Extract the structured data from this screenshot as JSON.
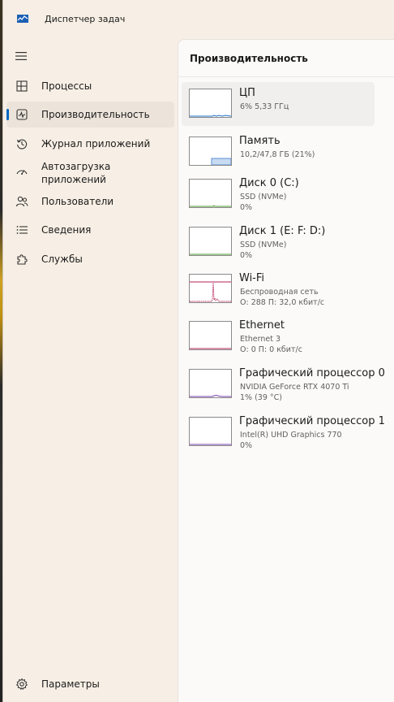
{
  "app": {
    "title": "Диспетчер задач",
    "icon": "task-manager-icon"
  },
  "nav": {
    "items": [
      {
        "label": "Процессы",
        "icon": "processes-grid-icon",
        "selected": false
      },
      {
        "label": "Производительность",
        "icon": "performance-chart-icon",
        "selected": true
      },
      {
        "label": "Журнал приложений",
        "icon": "history-clock-icon",
        "selected": false
      },
      {
        "label_line1": "Автозагрузка",
        "label_line2": "приложений",
        "icon": "startup-gauge-icon",
        "selected": false
      },
      {
        "label": "Пользователи",
        "icon": "users-icon",
        "selected": false
      },
      {
        "label": "Сведения",
        "icon": "details-list-icon",
        "selected": false
      },
      {
        "label": "Службы",
        "icon": "services-puzzle-icon",
        "selected": false
      }
    ],
    "settings_label": "Параметры"
  },
  "main": {
    "header": "Производительность",
    "items": [
      {
        "title": "ЦП",
        "line1": "6%  5,33 ГГц",
        "line2": "",
        "line3": "",
        "color": "#1f6fc5"
      },
      {
        "title": "Память",
        "line1": "10,2/47,8 ГБ (21%)",
        "line2": "",
        "line3": "",
        "color": "#5a8fd6"
      },
      {
        "title": "Диск 0 (C:)",
        "line1": "SSD (NVMe)",
        "line2": "0%",
        "line3": "",
        "color": "#4c9a2a"
      },
      {
        "title": "Диск 1 (E: F: D:)",
        "line1": "SSD (NVMe)",
        "line2": "0%",
        "line3": "",
        "color": "#4c9a2a"
      },
      {
        "title": "Wi-Fi",
        "line1": "Беспроводная сеть",
        "line2": "О: 288 П: 32,0 кбит/с",
        "line3": "",
        "color": "#b4235a"
      },
      {
        "title": "Ethernet",
        "line1": "Ethernet 3",
        "line2": "О: 0 П: 0 кбит/с",
        "line3": "",
        "color": "#b4235a"
      },
      {
        "title": "Графический процессор 0",
        "line1": "NVIDIA GeForce RTX 4070 Ti",
        "line2": "1%  (39 °C)",
        "line3": "",
        "color": "#7a3fb0"
      },
      {
        "title": "Графический процессор 1",
        "line1": "Intel(R) UHD Graphics 770",
        "line2": "0%",
        "line3": "",
        "color": "#7a3fb0"
      }
    ]
  },
  "colors": {
    "accent": "#0067c0",
    "window_bg": "#f7efe5",
    "content_bg": "#fbfaf9"
  }
}
